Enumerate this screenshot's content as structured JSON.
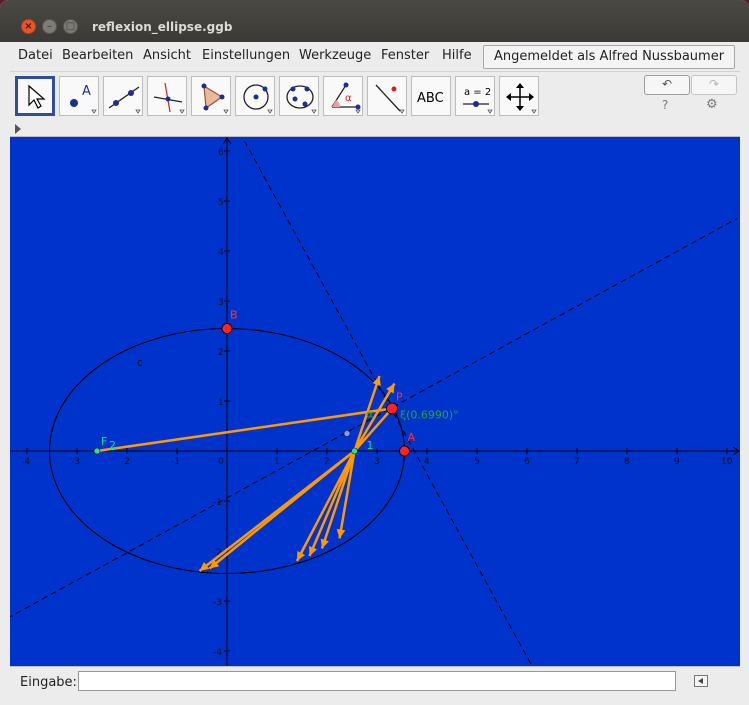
{
  "window": {
    "title": "reflexion_ellipse.ggb"
  },
  "menu": [
    "Datei",
    "Bearbeiten",
    "Ansicht",
    "Einstellungen",
    "Werkzeuge",
    "Fenster",
    "Hilfe"
  ],
  "login_label": "Angemeldet als Alfred Nussbaumer",
  "toolbar": {
    "undo_icon": "undo-icon",
    "redo_icon": "redo-icon",
    "help_label": "?",
    "settings_icon": "gear-icon",
    "tools": [
      {
        "name": "move-tool",
        "icon": "cursor-arrow-icon",
        "selected": true
      },
      {
        "name": "point-tool",
        "icon": "point-icon",
        "text": "A"
      },
      {
        "name": "line-tool",
        "icon": "line-through-points-icon"
      },
      {
        "name": "perpendicular-tool",
        "icon": "perpendicular-line-icon"
      },
      {
        "name": "polygon-tool",
        "icon": "polygon-icon"
      },
      {
        "name": "circle-tool",
        "icon": "circle-center-point-icon"
      },
      {
        "name": "conic-tool",
        "icon": "conic-five-points-icon"
      },
      {
        "name": "angle-tool",
        "icon": "angle-icon",
        "text": "α"
      },
      {
        "name": "reflect-tool",
        "icon": "reflect-about-line-icon"
      },
      {
        "name": "text-tool",
        "icon": "text-icon",
        "text": "ABC"
      },
      {
        "name": "slider-tool",
        "icon": "slider-icon",
        "text": "a = 2"
      },
      {
        "name": "move-view-tool",
        "icon": "move-graphics-view-icon"
      }
    ]
  },
  "input_bar": {
    "label": "Eingabe:",
    "value": "",
    "placeholder": ""
  },
  "graphics": {
    "background": "#0033cc",
    "ray_color": "#ff9900",
    "x_ticks": [
      "-4",
      "-3",
      "-2",
      "-1",
      "0",
      "1",
      "2",
      "3",
      "4",
      "5",
      "6",
      "7",
      "8",
      "9",
      "10"
    ],
    "y_ticks": [
      "6",
      "5",
      "4",
      "3",
      "2",
      "1",
      "-1",
      "-2",
      "-3",
      "-4"
    ],
    "labels": {
      "B": "B",
      "c": "c",
      "P": "P",
      "A": "A",
      "F": "F",
      "F_sub": "2",
      "one": "1",
      "angle": "α",
      "angle_value": "ξ(0.6990)°"
    },
    "ellipse": {
      "center": [
        0,
        0
      ],
      "a": 3.55,
      "b": 2.45
    },
    "points": {
      "B": [
        0,
        2.45
      ],
      "A": [
        3.55,
        0
      ],
      "P": [
        3.3,
        0.85
      ],
      "F2": [
        -2.6,
        0
      ],
      "F1": [
        2.55,
        0
      ],
      "small": [
        2.4,
        0.35
      ]
    },
    "rays": [
      {
        "from": [
          -2.6,
          0
        ],
        "to": [
          3.3,
          0.85
        ]
      },
      {
        "from": [
          3.3,
          0.85
        ],
        "to": [
          2.55,
          0
        ]
      },
      {
        "from": [
          2.55,
          0
        ],
        "to": [
          -0.55,
          -2.4
        ]
      },
      {
        "from": [
          2.55,
          0
        ],
        "to": [
          -0.35,
          -2.35
        ]
      },
      {
        "from": [
          2.55,
          0
        ],
        "to": [
          1.4,
          -2.2
        ]
      },
      {
        "from": [
          2.55,
          0
        ],
        "to": [
          1.65,
          -2.1
        ]
      },
      {
        "from": [
          2.55,
          0
        ],
        "to": [
          1.9,
          -1.95
        ]
      },
      {
        "from": [
          2.55,
          0
        ],
        "to": [
          2.25,
          -1.75
        ]
      },
      {
        "from": [
          2.55,
          0
        ],
        "to": [
          3.05,
          1.5
        ]
      },
      {
        "from": [
          2.55,
          0
        ],
        "to": [
          3.35,
          1.35
        ]
      }
    ]
  }
}
